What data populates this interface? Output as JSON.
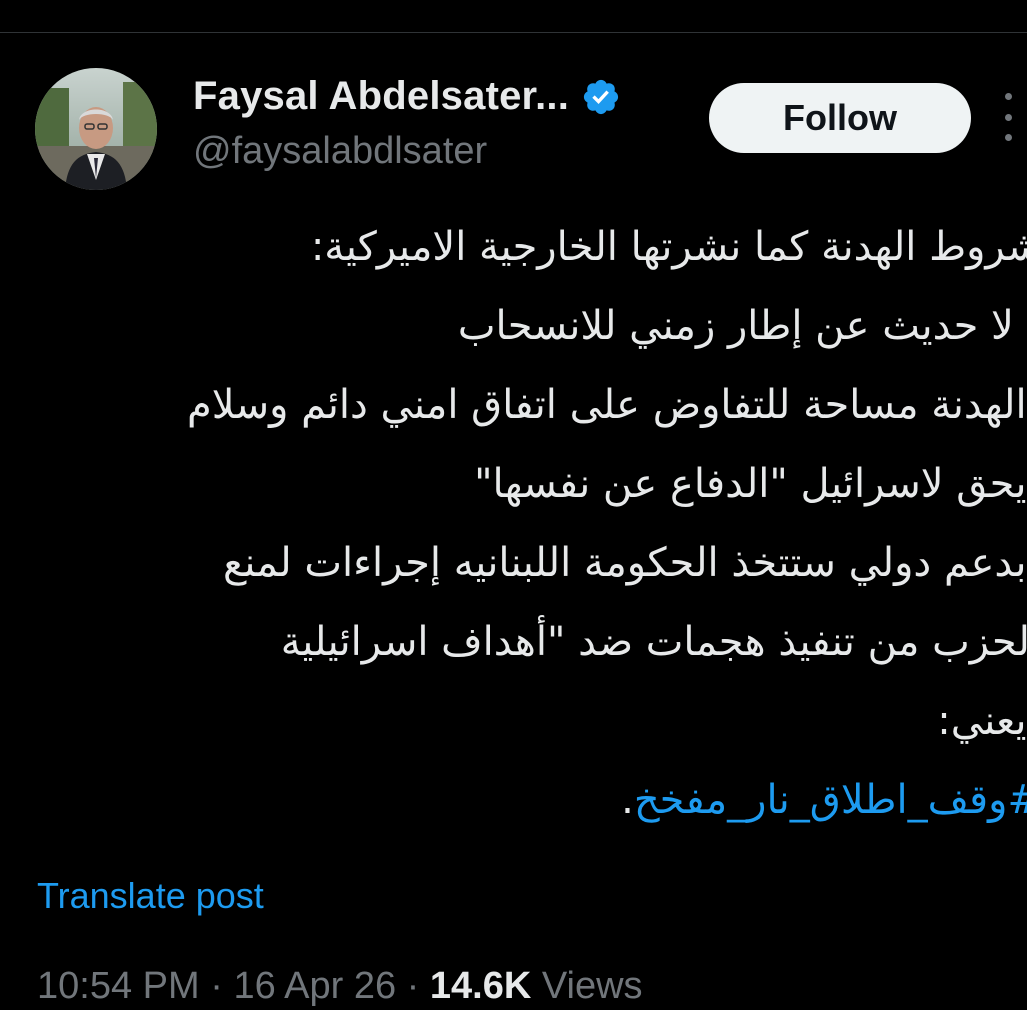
{
  "author": {
    "display_name": "Faysal Abdelsater...",
    "handle": "@faysalabdlsater",
    "verified": true,
    "avatar_icon": "profile-photo"
  },
  "follow_button": {
    "label": "Follow"
  },
  "tweet": {
    "lines": [
      "شروط الهدنة كما نشرتها الخارجية الاميركية:",
      "- لا حديث عن إطار زمني للانسحاب",
      "-الهدنة مساحة للتفاوض على اتفاق امني دائم وسلام",
      "-يحق لاسرائيل \"الدفاع عن نفسها\"",
      "-بدعم دولي ستتخذ الحكومة اللبنانيه إجراءات لمنع",
      "الحزب من تنفيذ هجمات ضد \"أهداف اسرائيلية",
      "-يعني:"
    ],
    "hashtag": "#وقف_اطلاق_نار_مفخخ",
    "hashtag_suffix": "."
  },
  "translate_label": "Translate post",
  "meta": {
    "time": "10:54 PM",
    "separator": " · ",
    "date": "16 Apr 26",
    "views_count": "14.6K",
    "views_label": " Views"
  },
  "colors": {
    "background": "#000000",
    "text": "#e7e9ea",
    "muted": "#71767b",
    "accent": "#1d9bf0"
  }
}
